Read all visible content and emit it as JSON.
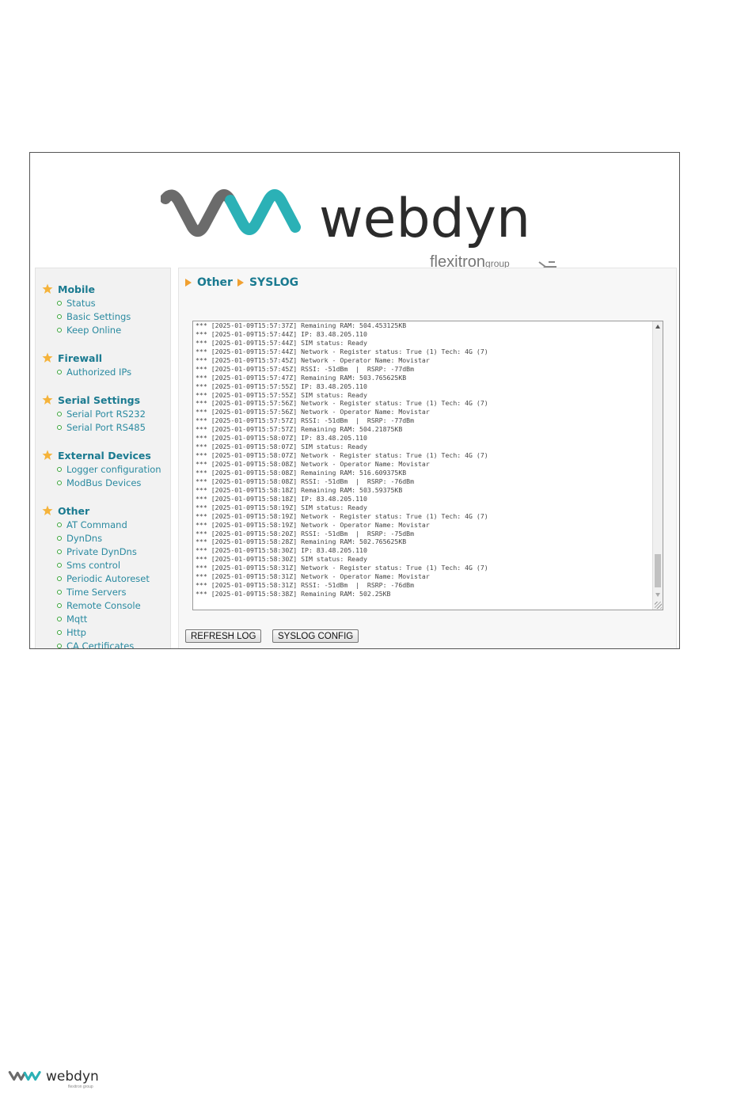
{
  "brand": {
    "name": "webdyn",
    "group": "flexitron",
    "group_suffix": "group",
    "colors": {
      "teal": "#2bb1b6",
      "gray": "#6b6b6b"
    }
  },
  "sidebar": {
    "groups": [
      {
        "title": "Mobile",
        "items": [
          "Status",
          "Basic Settings",
          "Keep Online"
        ]
      },
      {
        "title": "Firewall",
        "items": [
          "Authorized IPs"
        ]
      },
      {
        "title": "Serial Settings",
        "items": [
          "Serial Port RS232",
          "Serial Port RS485"
        ]
      },
      {
        "title": "External Devices",
        "items": [
          "Logger configuration",
          "ModBus Devices"
        ]
      },
      {
        "title": "Other",
        "items": [
          "AT Command",
          "DynDns",
          "Private DynDns",
          "Sms control",
          "Periodic Autoreset",
          "Time Servers",
          "Remote Console",
          "Mqtt",
          "Http",
          "CA Certificates"
        ]
      }
    ]
  },
  "breadcrumb": {
    "section": "Other",
    "page": "SYSLOG"
  },
  "log": {
    "lines": [
      "*** [2025-01-09T15:57:37Z] Remaining RAM: 504.453125KB",
      "*** [2025-01-09T15:57:44Z] IP: 83.48.205.110",
      "*** [2025-01-09T15:57:44Z] SIM status: Ready",
      "*** [2025-01-09T15:57:44Z] Network - Register status: True (1) Tech: 4G (7)",
      "*** [2025-01-09T15:57:45Z] Network - Operator Name: Movistar",
      "*** [2025-01-09T15:57:45Z] RSSI: -51dBm  |  RSRP: -77dBm",
      "*** [2025-01-09T15:57:47Z] Remaining RAM: 503.765625KB",
      "*** [2025-01-09T15:57:55Z] IP: 83.48.205.110",
      "*** [2025-01-09T15:57:55Z] SIM status: Ready",
      "*** [2025-01-09T15:57:56Z] Network - Register status: True (1) Tech: 4G (7)",
      "*** [2025-01-09T15:57:56Z] Network - Operator Name: Movistar",
      "*** [2025-01-09T15:57:57Z] RSSI: -51dBm  |  RSRP: -77dBm",
      "*** [2025-01-09T15:57:57Z] Remaining RAM: 504.21875KB",
      "*** [2025-01-09T15:58:07Z] IP: 83.48.205.110",
      "*** [2025-01-09T15:58:07Z] SIM status: Ready",
      "*** [2025-01-09T15:58:07Z] Network - Register status: True (1) Tech: 4G (7)",
      "*** [2025-01-09T15:58:08Z] Network - Operator Name: Movistar",
      "*** [2025-01-09T15:58:08Z] Remaining RAM: 516.609375KB",
      "*** [2025-01-09T15:58:08Z] RSSI: -51dBm  |  RSRP: -76dBm",
      "*** [2025-01-09T15:58:18Z] Remaining RAM: 503.59375KB",
      "*** [2025-01-09T15:58:18Z] IP: 83.48.205.110",
      "*** [2025-01-09T15:58:19Z] SIM status: Ready",
      "*** [2025-01-09T15:58:19Z] Network - Register status: True (1) Tech: 4G (7)",
      "*** [2025-01-09T15:58:19Z] Network - Operator Name: Movistar",
      "*** [2025-01-09T15:58:20Z] RSSI: -51dBm  |  RSRP: -75dBm",
      "*** [2025-01-09T15:58:28Z] Remaining RAM: 502.765625KB",
      "*** [2025-01-09T15:58:30Z] IP: 83.48.205.110",
      "*** [2025-01-09T15:58:30Z] SIM status: Ready",
      "*** [2025-01-09T15:58:31Z] Network - Register status: True (1) Tech: 4G (7)",
      "*** [2025-01-09T15:58:31Z] Network - Operator Name: Movistar",
      "*** [2025-01-09T15:58:31Z] RSSI: -51dBm  |  RSRP: -76dBm",
      "*** [2025-01-09T15:58:38Z] Remaining RAM: 502.25KB"
    ]
  },
  "buttons": {
    "refresh": "REFRESH LOG",
    "config": "SYSLOG CONFIG"
  },
  "footer": {
    "brand": "webdyn",
    "group": "flexitron group"
  }
}
